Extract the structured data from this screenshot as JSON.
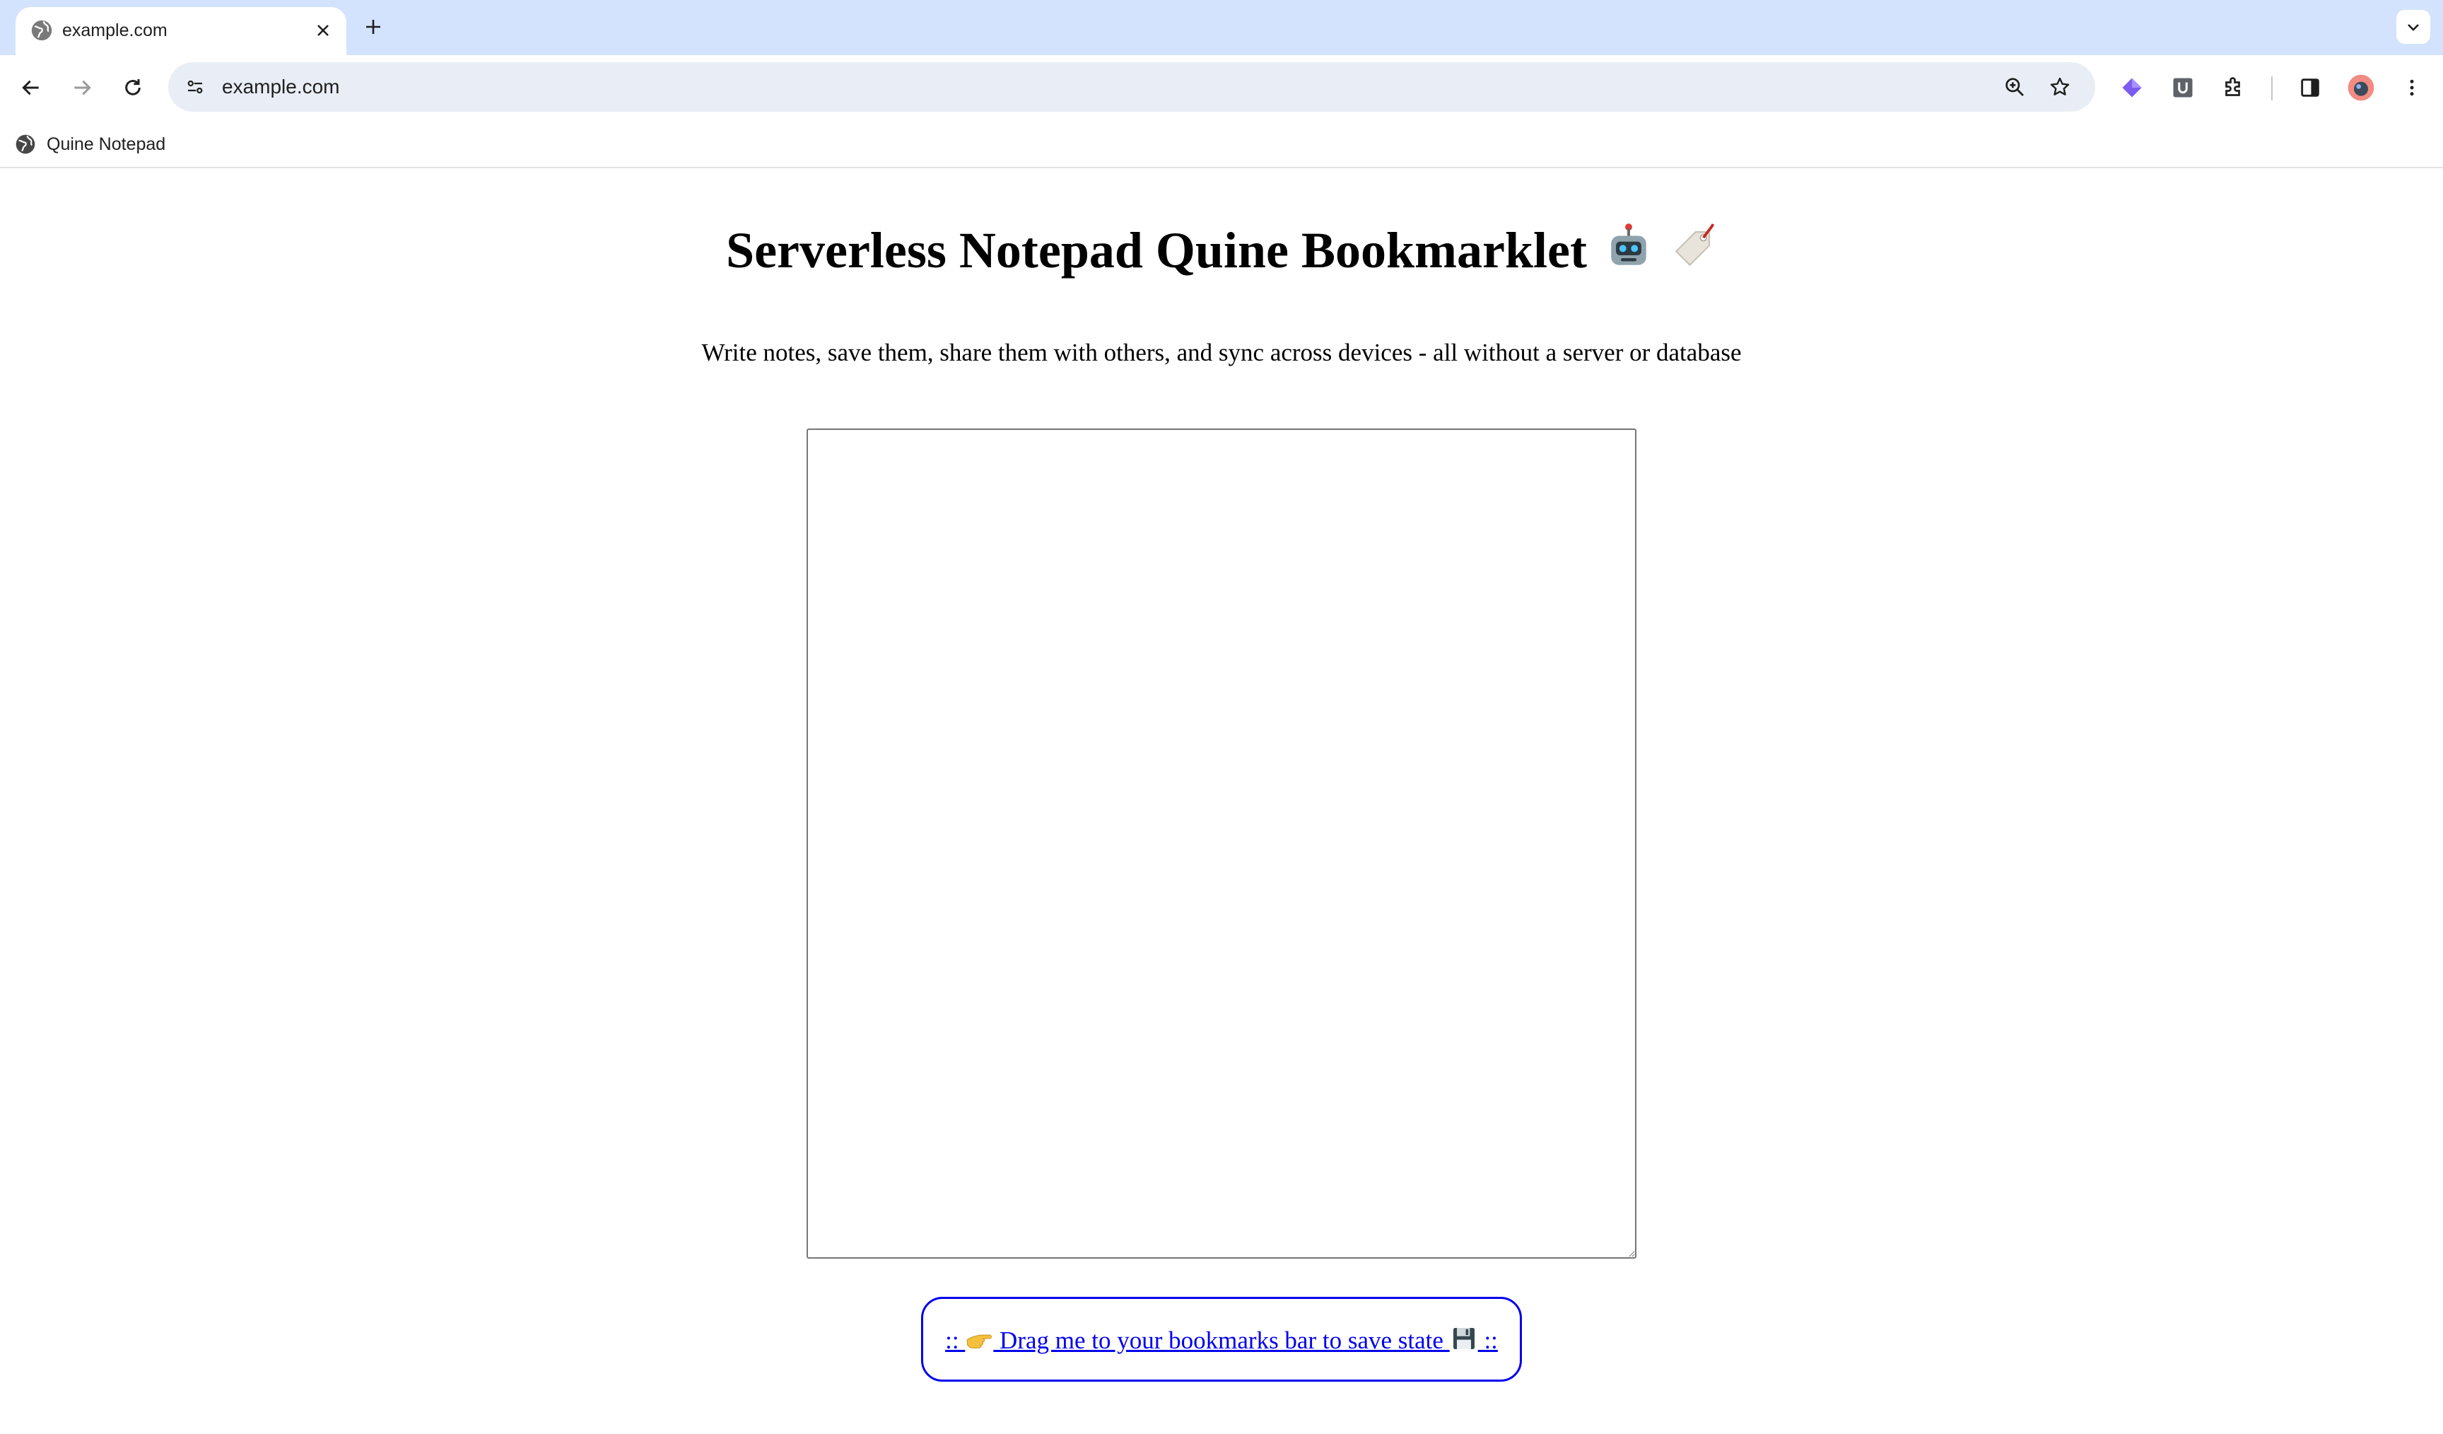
{
  "browser": {
    "tab": {
      "title": "example.com",
      "favicon": "globe-icon"
    },
    "new_tab_icon": "plus-icon",
    "address_bar": {
      "url": "example.com"
    },
    "bookmarks": [
      {
        "label": "Quine Notepad",
        "icon": "globe-icon"
      }
    ]
  },
  "page": {
    "title": "Serverless Notepad Quine Bookmarklet",
    "title_emojis": [
      "robot-emoji",
      "tag-emoji"
    ],
    "subtitle": "Write notes, save them, share them with others, and sync across devices - all without a server or database",
    "notepad": {
      "value": ""
    },
    "bookmarklet": {
      "prefix": ":: ",
      "label": " Drag me to your bookmarks bar to save state ",
      "suffix": " ::",
      "icons": [
        "pointing-hand-emoji",
        "floppy-disk-emoji"
      ]
    }
  },
  "colors": {
    "tabstrip": "#d3e3fd",
    "omnibox": "#e9eef6",
    "link": "#0000ee"
  }
}
